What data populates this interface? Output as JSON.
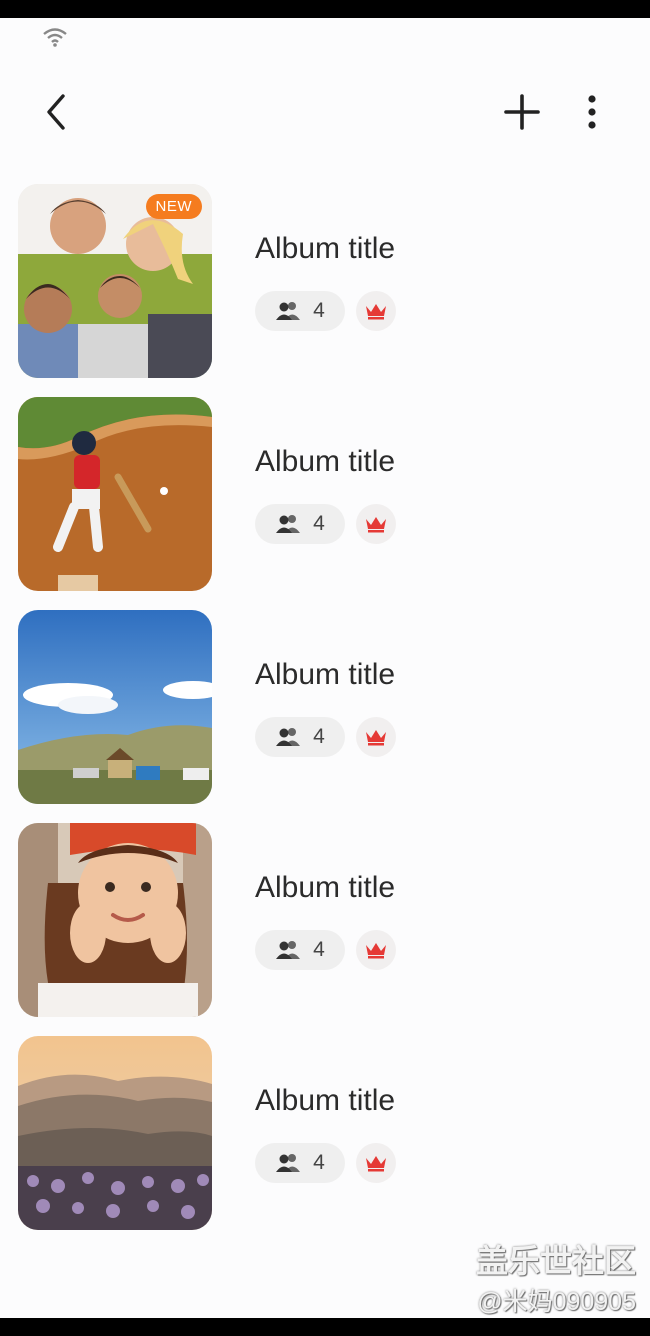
{
  "albums": [
    {
      "title": "Album title",
      "members": "4",
      "badge": "NEW",
      "image": "family"
    },
    {
      "title": "Album title",
      "members": "4",
      "badge": "",
      "image": "baseball"
    },
    {
      "title": "Album title",
      "members": "4",
      "badge": "",
      "image": "landscape"
    },
    {
      "title": "Album title",
      "members": "4",
      "badge": "",
      "image": "girl"
    },
    {
      "title": "Album title",
      "members": "4",
      "badge": "",
      "image": "mountains"
    }
  ],
  "icons": {
    "back": "back-arrow-icon",
    "add": "plus-icon",
    "more": "more-vertical-icon",
    "members": "people-icon",
    "owner": "crown-icon",
    "wifi": "wifi-icon"
  },
  "colors": {
    "badge": "#f57c1f",
    "crown": "#e53935",
    "chip": "#efefef"
  },
  "watermark": {
    "line1": "盖乐世社区",
    "line2": "@米妈090905"
  }
}
